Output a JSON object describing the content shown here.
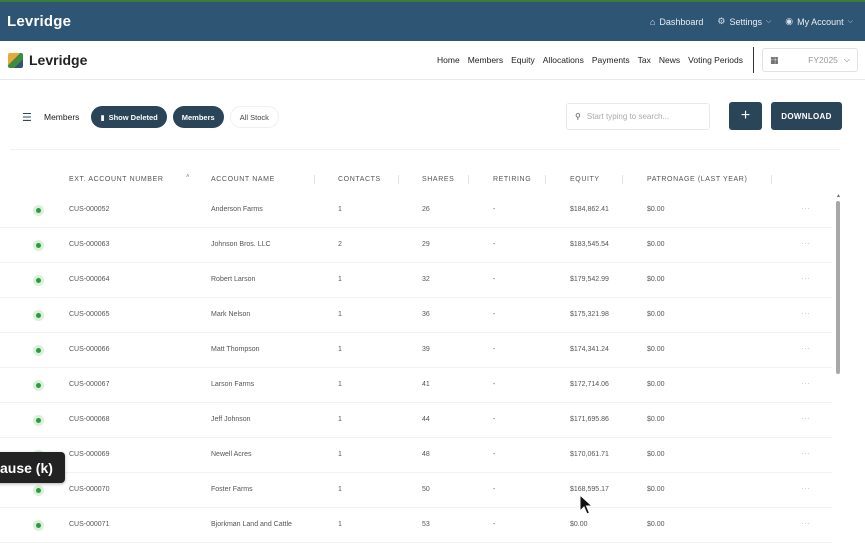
{
  "topbar": {
    "brand": "Levridge",
    "dashboard": "Dashboard",
    "settings": "Settings",
    "account": "My Account"
  },
  "nav": {
    "logo_text": "Levridge",
    "links": [
      "Home",
      "Members",
      "Equity",
      "Allocations",
      "Payments",
      "Tax",
      "News",
      "Voting Periods"
    ],
    "fiscal_year": "FY2025"
  },
  "toolbar": {
    "members_label": "Members",
    "show_deleted": "Show Deleted",
    "members_pill": "Members",
    "all_stock": "All Stock",
    "search_placeholder": "Start typing to search...",
    "plus_label": "+",
    "download_label": "DOWNLOAD"
  },
  "table": {
    "headers": [
      "EXT. ACCOUNT NUMBER",
      "ACCOUNT NAME",
      "CONTACTS",
      "SHARES",
      "RETIRING",
      "EQUITY",
      "PATRONAGE (LAST YEAR)"
    ],
    "rows": [
      {
        "ext": "CUS-000052",
        "name": "Anderson Farms",
        "contacts": "1",
        "shares": "26",
        "retiring": "-",
        "equity": "$184,862.41",
        "patronage": "$0.00"
      },
      {
        "ext": "CUS-000063",
        "name": "Johnson Bros. LLC",
        "contacts": "2",
        "shares": "29",
        "retiring": "-",
        "equity": "$183,545.54",
        "patronage": "$0.00"
      },
      {
        "ext": "CUS-000064",
        "name": "Robert Larson",
        "contacts": "1",
        "shares": "32",
        "retiring": "-",
        "equity": "$179,542.99",
        "patronage": "$0.00"
      },
      {
        "ext": "CUS-000065",
        "name": "Mark Nelson",
        "contacts": "1",
        "shares": "36",
        "retiring": "-",
        "equity": "$175,321.98",
        "patronage": "$0.00"
      },
      {
        "ext": "CUS-000066",
        "name": "Matt Thompson",
        "contacts": "1",
        "shares": "39",
        "retiring": "-",
        "equity": "$174,341.24",
        "patronage": "$0.00"
      },
      {
        "ext": "CUS-000067",
        "name": "Larson Farms",
        "contacts": "1",
        "shares": "41",
        "retiring": "-",
        "equity": "$172,714.06",
        "patronage": "$0.00"
      },
      {
        "ext": "CUS-000068",
        "name": "Jeff Johnson",
        "contacts": "1",
        "shares": "44",
        "retiring": "-",
        "equity": "$171,695.86",
        "patronage": "$0.00"
      },
      {
        "ext": "CUS-000069",
        "name": "Newell Acres",
        "contacts": "1",
        "shares": "48",
        "retiring": "-",
        "equity": "$170,061.71",
        "patronage": "$0.00"
      },
      {
        "ext": "CUS-000070",
        "name": "Foster Farms",
        "contacts": "1",
        "shares": "50",
        "retiring": "-",
        "equity": "$168,595.17",
        "patronage": "$0.00"
      },
      {
        "ext": "CUS-000071",
        "name": "Bjorkman Land and Cattle",
        "contacts": "1",
        "shares": "53",
        "retiring": "-",
        "equity": "$0.00",
        "patronage": "$0.00"
      }
    ],
    "more_label": "···"
  },
  "overlay": {
    "pause_text": "ause (k)"
  },
  "colors": {
    "header_bg": "#2f5575",
    "button_dark": "#2a4458",
    "status_green": "#2e9a40"
  }
}
